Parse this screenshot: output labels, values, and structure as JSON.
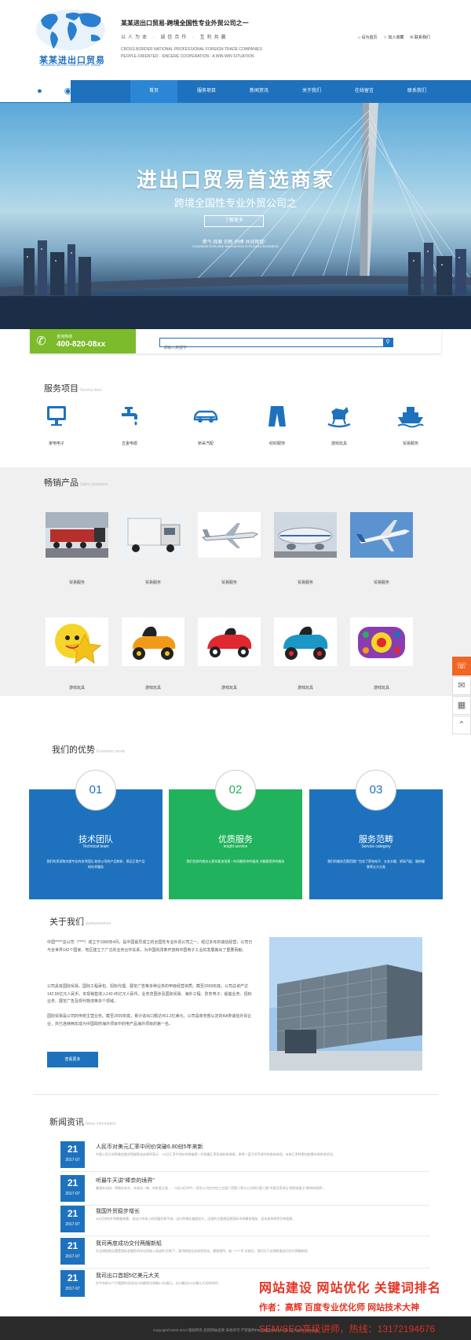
{
  "header": {
    "logo_text": "某某进出口贸易",
    "logo_sub": "MOUMOU IMPORT AND EXPORT TRADE",
    "company_title": "某某进出口贸易-跨境全国性专业外贸公司之一",
    "slogan_cn": "以人为本 · 诚信合作 · 互利共赢",
    "slogan_en1": "CROSS BORDER NATIONAL PROFESSIONAL FOREIGN TRADE COMPANIES",
    "slogan_en2": "PEOPLE-ORIENTED - SINCERE COOPERATION - A WIN-WIN SITUATION",
    "links": [
      "设为首页",
      "加入收藏",
      "联系我们"
    ]
  },
  "nav": {
    "items": [
      "首页",
      "服务项目",
      "新闻资讯",
      "关于我们",
      "在线留言",
      "联系我们"
    ],
    "active": 0
  },
  "banner": {
    "title": "进出口贸易首选商家",
    "subtitle": "跨境全国性专业外贸公司之",
    "more": "了解更多",
    "tagline_cn": "勇气 探索 创新 拼搏 共创辉煌！",
    "tagline_en": "COURAGE EXPLORE INNOVATION STRUGGLE BUZINESS"
  },
  "hotline": {
    "label": "咨询热线",
    "number": "400-820-08xx"
  },
  "search": {
    "placeholder": "请输入关键字"
  },
  "services": {
    "title": "服务项目",
    "title_en": "Service item",
    "items": [
      {
        "label": "家电电子",
        "icon": "monitor-icon"
      },
      {
        "label": "五金电缆",
        "icon": "faucet-icon"
      },
      {
        "label": "轿采汽配",
        "icon": "car-icon"
      },
      {
        "label": "纺织服饰",
        "icon": "pants-icon"
      },
      {
        "label": "游戏玩具",
        "icon": "rocking-horse-icon"
      },
      {
        "label": "贸易服务",
        "icon": "ship-icon"
      }
    ]
  },
  "products": {
    "title": "畅销产品",
    "title_en": "Sales champion",
    "row1": [
      "贸易服务",
      "贸易服务",
      "贸易服务",
      "贸易服务",
      "贸易服务"
    ],
    "row2": [
      "游戏玩具",
      "游戏玩具",
      "游戏玩具",
      "游戏玩具",
      "游戏玩具"
    ]
  },
  "advantages": {
    "title": "我们的优势",
    "title_en": "Economic vvvvb",
    "cards": [
      {
        "num": "01",
        "title": "技术团队",
        "title_en": "Technical team",
        "desc": "我们的资深购内部专业的技术团队,助合公司的产品和研，保证正常产品的技术服务",
        "color": "#1e72bd"
      },
      {
        "num": "02",
        "title": "优质服务",
        "title_en": "knight service",
        "desc": "我们优质的服务让客系要加强第一时间翻答你的疑虑,为翻客提供的服务",
        "color": "#20b25c"
      },
      {
        "num": "03",
        "title": "服务范畴",
        "title_en": "Service category",
        "desc": "我们的服务范围范围广包含了家电电子、五金水暖、轿采汽配、服饰服装等五大分类",
        "color": "#1e72bd"
      }
    ]
  },
  "about": {
    "title": "关于我们",
    "title_en": "guanyuwomen",
    "p1": "中国*****总公司（****）成立于1980年4月，是中国最早成立的全国性专业外贸公司之一。经过多年的诚信经营，公司已与全世界142个国家、地区建立了广泛的业务合作关系，为中国的改革开放和中国电子工业的发展做出了重要贡献。",
    "p2": "公司具有国际贸易、国际工程承包、招标代理、展览广告等多种业务的甲级经营资质。截至2009年底，公司总资产达142.56亿元人民币，实现销售收入142.45亿元人民币，业务范围涉及国际贸易、海外工程、防务电子、船舶业务、招标业务、展览广告及现代物流等多个领域。",
    "p3": "国际贸易是公司的传统主营业务。截至2009年底，累计进出口额达451.2亿美元。公司是商务部认定的AA类诚信外贸企业，并已连续两年成为中国政府海外项目中的电产品海外项目的第一名。",
    "button": "查看更多"
  },
  "news": {
    "title": "新闻资讯",
    "title_en": "News information",
    "items": [
      {
        "day": "21",
        "ym": "2017-07",
        "title": "人民币对美元汇率中间价突破6.80创5年来新",
        "summary": "中国人民大学财政金融学院副院长赵锡军表示：“22日汇率中间价的突破是一步稳健汇率形成机制改革，参考一篮子货币调节的具体体现，未来汇率将更加依靠市场供求状况。"
      },
      {
        "day": "21",
        "ym": "2017-07",
        "title": "听最牛天讲“棒奈的境界”",
        "summary": "最强本无树，明镜亦非台，本来无一物，何处惹尘埃……”5月25日中午，宿仑公司在中信工业园广西第二季分公司举行第三期“书香至家讲坛”视频讲座之“棒奈的境界”。"
      },
      {
        "day": "21",
        "ym": "2017-07",
        "title": "我国外贸稳步增长",
        "summary": "从5月份的外贸数据来看，进出口市场上的回暖形势不减，出口的增长幅度较大，出现的主要原因是国际市场需求增加，但未来持续性仍待观察。"
      },
      {
        "day": "21",
        "ym": "2017-07",
        "title": "我司再度成功交付两艘新船",
        "summary": "在全球船舶业遭受国际金融危机冲击而陷入低迷的 形势下，我司船舶业务逆势而动，捷报频传。继 “*****”号 交船后，我司又于近期再度成功交付两艘新船"
      },
      {
        "day": "21",
        "ym": "2017-07",
        "title": "我司出口首超5亿美元大关",
        "summary": "在今年前11个月我国外经进出口业额首次突破5.5亿美元，出口额达5.5亿美元大关的同时，"
      }
    ]
  },
  "watermark": {
    "line1": "网站建设  网站优化  关键词排名",
    "line2": "作者：高辉    百度专业优化师    网站技术大神",
    "line3": "SEM/SEO高级讲师，热线：13172194676"
  },
  "footer": {
    "text": "Copyright©2004-2014 版权所有 您的网站名称 未经许可 严禁复制PBCP备XXXXXXX号 All Rights Reserve"
  },
  "side_tools": [
    "phone-icon",
    "chat-icon",
    "qrcode-icon",
    "top-icon"
  ],
  "colors": {
    "primary": "#1e72bd",
    "green": "#20b25c",
    "hotline_green": "#7cbb2c",
    "accent_orange": "#f06622",
    "watermark_red": "#e63322"
  }
}
